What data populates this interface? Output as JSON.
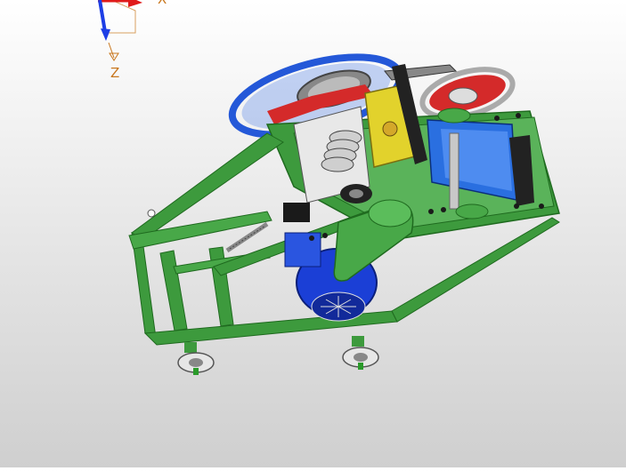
{
  "viewport": {
    "triad": {
      "x_label": "X",
      "z_label": "Z",
      "colors": {
        "x_axis": "#e01a1a",
        "y_axis": "#2a9a2a",
        "z_axis": "#1d3ee6",
        "label": "#c8761c"
      }
    },
    "model": {
      "colors": {
        "frame": "#3d9a3d",
        "frame_dark": "#1f6a1f",
        "motor": "#1b3fd6",
        "pulley_red": "#d42a2a",
        "belt_blue": "#2458d8",
        "guard_green": "#48a848",
        "cutter_yellow": "#e2d22c",
        "wheel": "#d8d8d8"
      }
    }
  }
}
